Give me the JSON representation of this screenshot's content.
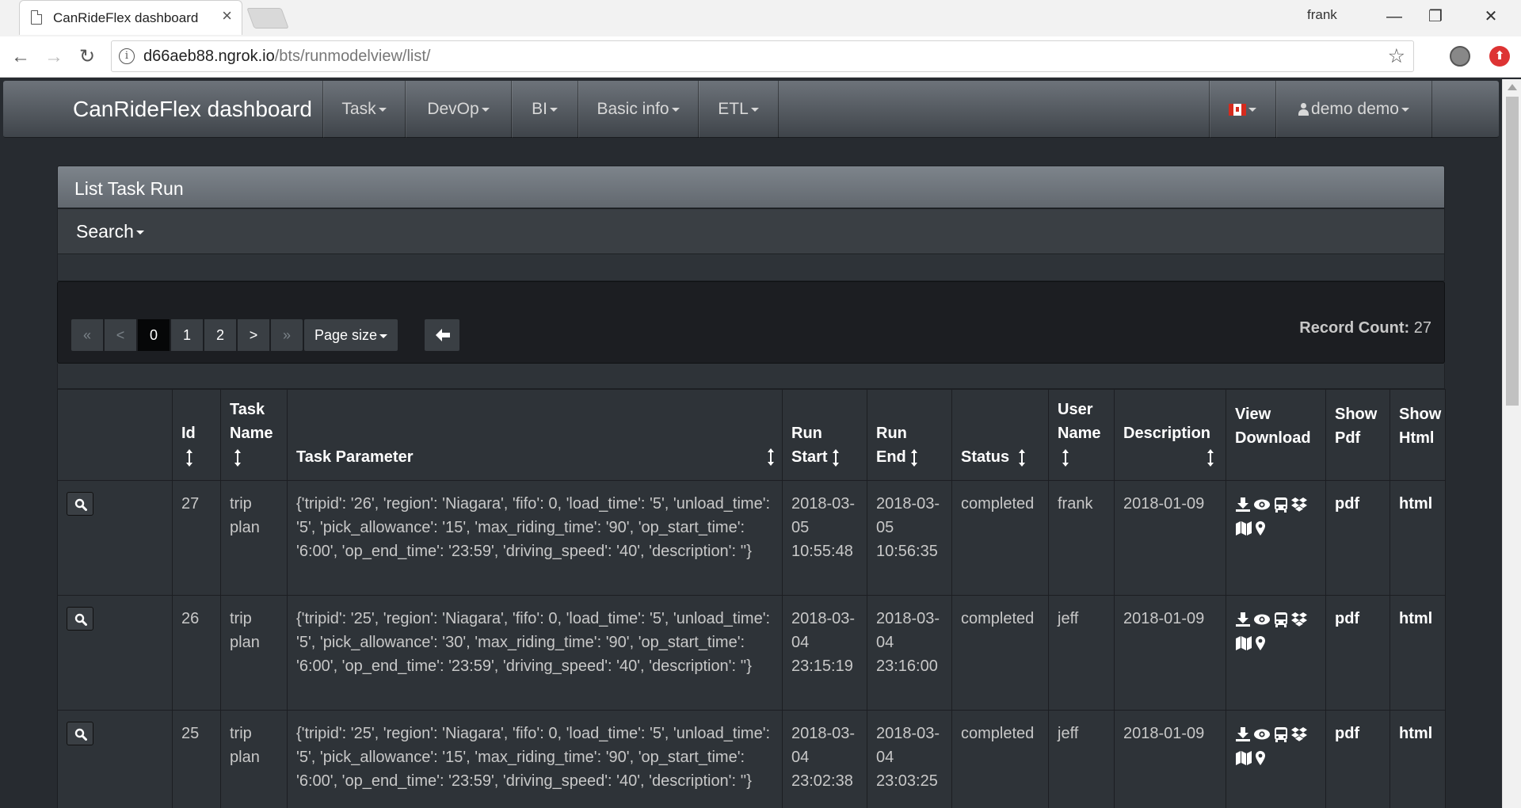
{
  "browser": {
    "tab_title": "CanRideFlex dashboard",
    "tab_close": "×",
    "profile_name": "frank",
    "url_host": "d66aeb88.ngrok.io",
    "url_path": "/bts/runmodelview/list/",
    "info_glyph": "i",
    "star_glyph": "☆",
    "min_glyph": "—",
    "max_glyph": "❐",
    "close_glyph": "✕",
    "back_glyph": "←",
    "forward_glyph": "→",
    "reload_glyph": "↻"
  },
  "navbar": {
    "brand": "CanRideFlex dashboard",
    "items": [
      {
        "label": "Task"
      },
      {
        "label": "DevOp"
      },
      {
        "label": "BI"
      },
      {
        "label": "Basic info"
      },
      {
        "label": "ETL"
      }
    ],
    "user": "demo demo"
  },
  "panel": {
    "title": "List Task Run",
    "search_label": "Search"
  },
  "pager": {
    "first": "«",
    "prev": "<",
    "pages": [
      "0",
      "1",
      "2"
    ],
    "active_page": "0",
    "next": ">",
    "last": "»",
    "page_size_label": "Page size",
    "record_count_label": "Record Count:",
    "record_count": "27"
  },
  "table": {
    "headers": {
      "id": "Id",
      "task_name_1": "Task",
      "task_name_2": "Name",
      "task_parameter": "Task Parameter",
      "run_start_1": "Run",
      "run_start_2": "Start",
      "run_end_1": "Run",
      "run_end_2": "End",
      "status": "Status",
      "user_name_1": "User",
      "user_name_2": "Name",
      "description": "Description",
      "view_download_1": "View",
      "view_download_2": "Download",
      "show_pdf_1": "Show",
      "show_pdf_2": "Pdf",
      "show_html_1": "Show",
      "show_html_2": "Html"
    },
    "rows": [
      {
        "id": "27",
        "task_name": "trip plan",
        "parameter": "{'tripid': '26', 'region': 'Niagara', 'fifo': 0, 'load_time': '5', 'unload_time': '5', 'pick_allowance': '15', 'max_riding_time': '90', 'op_start_time': '6:00', 'op_end_time': '23:59', 'driving_speed': '40', 'description': ''}",
        "run_start": "2018-03-05 10:55:48",
        "run_end": "2018-03-05 10:56:35",
        "status": "completed",
        "user": "frank",
        "description": "2018-01-09",
        "pdf": "pdf",
        "html": "html"
      },
      {
        "id": "26",
        "task_name": "trip plan",
        "parameter": "{'tripid': '25', 'region': 'Niagara', 'fifo': 0, 'load_time': '5', 'unload_time': '5', 'pick_allowance': '30', 'max_riding_time': '90', 'op_start_time': '6:00', 'op_end_time': '23:59', 'driving_speed': '40', 'description': ''}",
        "run_start": "2018-03-04 23:15:19",
        "run_end": "2018-03-04 23:16:00",
        "status": "completed",
        "user": "jeff",
        "description": "2018-01-09",
        "pdf": "pdf",
        "html": "html"
      },
      {
        "id": "25",
        "task_name": "trip plan",
        "parameter": "{'tripid': '25', 'region': 'Niagara', 'fifo': 0, 'load_time': '5', 'unload_time': '5', 'pick_allowance': '15', 'max_riding_time': '90', 'op_start_time': '6:00', 'op_end_time': '23:59', 'driving_speed': '40', 'description': ''}",
        "run_start": "2018-03-04 23:02:38",
        "run_end": "2018-03-04 23:03:25",
        "status": "completed",
        "user": "jeff",
        "description": "2018-01-09",
        "pdf": "pdf",
        "html": "html"
      }
    ]
  },
  "theme": {
    "page_bg": "#272b30",
    "panel_head": "#7d848b",
    "cell_bg": "#2e3338",
    "well_bg": "#1c1e22"
  }
}
